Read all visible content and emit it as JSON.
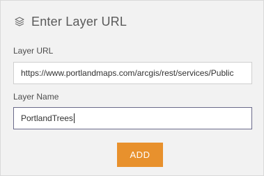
{
  "header": {
    "icon": "layers-icon",
    "title": "Enter Layer URL"
  },
  "layer_url": {
    "label": "Layer URL",
    "value": "https://www.portlandmaps.com/arcgis/rest/services/Public"
  },
  "layer_name": {
    "label": "Layer Name",
    "value": "PortlandTrees"
  },
  "add_button": {
    "label": "ADD",
    "color": "#e8912d"
  }
}
